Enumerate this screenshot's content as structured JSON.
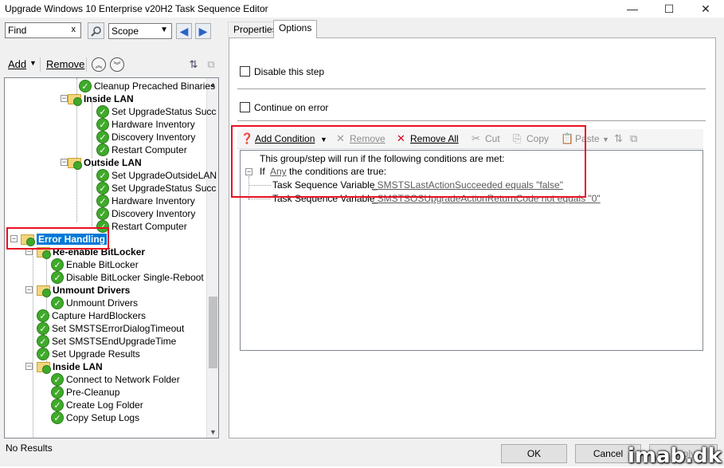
{
  "window": {
    "title": "Upgrade Windows 10 Enterprise v20H2 Task Sequence Editor",
    "minimize": "—",
    "maximize": "☐",
    "close": "✕"
  },
  "left": {
    "find_value": "Find",
    "find_clear": "x",
    "scope_value": "Scope",
    "add_label": "Add",
    "remove_label": "Remove"
  },
  "tree": [
    {
      "id": "n0",
      "label": "Cleanup Precached Binaries",
      "type": "step",
      "icon": "check-icon"
    },
    {
      "id": "n1",
      "label": "Inside LAN",
      "type": "group",
      "icon": "folder-icon"
    },
    {
      "id": "n2",
      "label": "Set UpgradeStatus Succ",
      "type": "step",
      "icon": "check-icon"
    },
    {
      "id": "n3",
      "label": "Hardware Inventory",
      "type": "step",
      "icon": "check-icon"
    },
    {
      "id": "n4",
      "label": "Discovery Inventory",
      "type": "step",
      "icon": "check-icon"
    },
    {
      "id": "n5",
      "label": "Restart Computer",
      "type": "step",
      "icon": "check-icon"
    },
    {
      "id": "n6",
      "label": "Outside LAN",
      "type": "group",
      "icon": "folder-icon"
    },
    {
      "id": "n7",
      "label": "Set UpgradeOutsideLAN",
      "type": "step",
      "icon": "check-icon"
    },
    {
      "id": "n8",
      "label": "Set UpgradeStatus Succ",
      "type": "step",
      "icon": "check-icon"
    },
    {
      "id": "n9",
      "label": "Hardware Inventory",
      "type": "step",
      "icon": "check-icon"
    },
    {
      "id": "n10",
      "label": "Discovery Inventory",
      "type": "step",
      "icon": "check-icon"
    },
    {
      "id": "n11",
      "label": "Restart Computer",
      "type": "step",
      "icon": "check-icon"
    },
    {
      "id": "n12",
      "label": "Error Handling",
      "type": "group",
      "icon": "folder-icon",
      "selected": true
    },
    {
      "id": "n13",
      "label": "Re-enable BitLocker",
      "type": "group",
      "icon": "folder-icon"
    },
    {
      "id": "n14",
      "label": "Enable BitLocker",
      "type": "step",
      "icon": "check-icon"
    },
    {
      "id": "n15",
      "label": "Disable BitLocker Single-Reboot",
      "type": "step",
      "icon": "check-icon"
    },
    {
      "id": "n16",
      "label": "Unmount Drivers",
      "type": "group",
      "icon": "folder-icon"
    },
    {
      "id": "n17",
      "label": "Unmount Drivers",
      "type": "step",
      "icon": "check-icon"
    },
    {
      "id": "n18",
      "label": "Capture HardBlockers",
      "type": "step",
      "icon": "check-icon"
    },
    {
      "id": "n19",
      "label": "Set SMSTSErrorDialogTimeout",
      "type": "step",
      "icon": "check-icon"
    },
    {
      "id": "n20",
      "label": "Set SMSTSEndUpgradeTime",
      "type": "step",
      "icon": "check-icon"
    },
    {
      "id": "n21",
      "label": "Set Upgrade Results",
      "type": "step",
      "icon": "check-icon"
    },
    {
      "id": "n22",
      "label": "Inside LAN",
      "type": "group",
      "icon": "folder-icon"
    },
    {
      "id": "n23",
      "label": "Connect to Network Folder",
      "type": "step",
      "icon": "check-icon"
    },
    {
      "id": "n24",
      "label": "Pre-Cleanup",
      "type": "step",
      "icon": "check-icon"
    },
    {
      "id": "n25",
      "label": "Create Log Folder",
      "type": "step",
      "icon": "check-icon"
    },
    {
      "id": "n26",
      "label": "Copy Setup Logs",
      "type": "step",
      "icon": "check-icon"
    }
  ],
  "tabs": [
    {
      "label": "Properties",
      "active": false
    },
    {
      "label": "Options",
      "active": true
    }
  ],
  "options": {
    "disable_step": "Disable this step",
    "continue_on_error": "Continue on error",
    "toolbar": {
      "add_condition": "Add Condition",
      "remove": "Remove",
      "remove_all": "Remove All",
      "cut": "Cut",
      "copy": "Copy",
      "paste": "Paste"
    },
    "conditions": {
      "header": "This group/step will run if the following conditions are met:",
      "if_label": "If",
      "any_link": "Any",
      "if_tail": "the conditions are true:",
      "rows": [
        {
          "type": "Task Sequence Variable",
          "expr": "_SMSTSLastActionSucceeded equals \"false\""
        },
        {
          "type": "Task Sequence Variable",
          "expr": "_SMSTSOSUpgradeActionReturnCode not equals \"0\""
        }
      ]
    }
  },
  "status": {
    "text": "No Results",
    "ok": "OK",
    "cancel": "Cancel",
    "apply": "Apply",
    "watermark": "imab.dk"
  }
}
